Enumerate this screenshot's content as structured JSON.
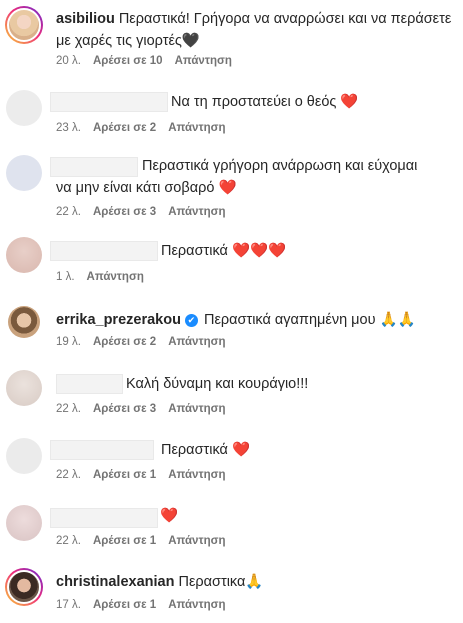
{
  "comments": [
    {
      "username": "asibiliou",
      "text": "Περαστικά! Γρήγορα να αναρρώσει και να περάσετε με χαρές τις γιορτές🖤",
      "time": "20 λ.",
      "likes": "Αρέσει σε 10",
      "reply": "Απάντηση"
    },
    {
      "text": "Να τη προστατεύει ο θεός ❤️",
      "time": "23 λ.",
      "likes": "Αρέσει σε 2",
      "reply": "Απάντηση"
    },
    {
      "text": "Περαστικά γρήγορη ανάρρωση και εύχομαι να μην είναι κάτι σοβαρό ❤️",
      "time": "22 λ.",
      "likes": "Αρέσει σε 3",
      "reply": "Απάντηση"
    },
    {
      "text": "Περαστικά ❤️❤️❤️",
      "time": "1 λ.",
      "reply": "Απάντηση"
    },
    {
      "username": "errika_prezerakou",
      "verified": "✔",
      "text": "Περαστικά αγαπημένη μου 🙏🙏",
      "time": "19 λ.",
      "likes": "Αρέσει σε 2",
      "reply": "Απάντηση"
    },
    {
      "text": "Καλή δύναμη και κουράγιο!!!",
      "time": "22 λ.",
      "likes": "Αρέσει σε 3",
      "reply": "Απάντηση"
    },
    {
      "text": "Περαστικά ❤️",
      "time": "22 λ.",
      "likes": "Αρέσει σε 1",
      "reply": "Απάντηση"
    },
    {
      "text": "❤️",
      "time": "22 λ.",
      "likes": "Αρέσει σε 1",
      "reply": "Απάντηση"
    },
    {
      "username": "christinalexanian",
      "text": "Περαστικα🙏",
      "time": "17 λ.",
      "likes": "Αρέσει σε 1",
      "reply": "Απάντηση"
    }
  ]
}
